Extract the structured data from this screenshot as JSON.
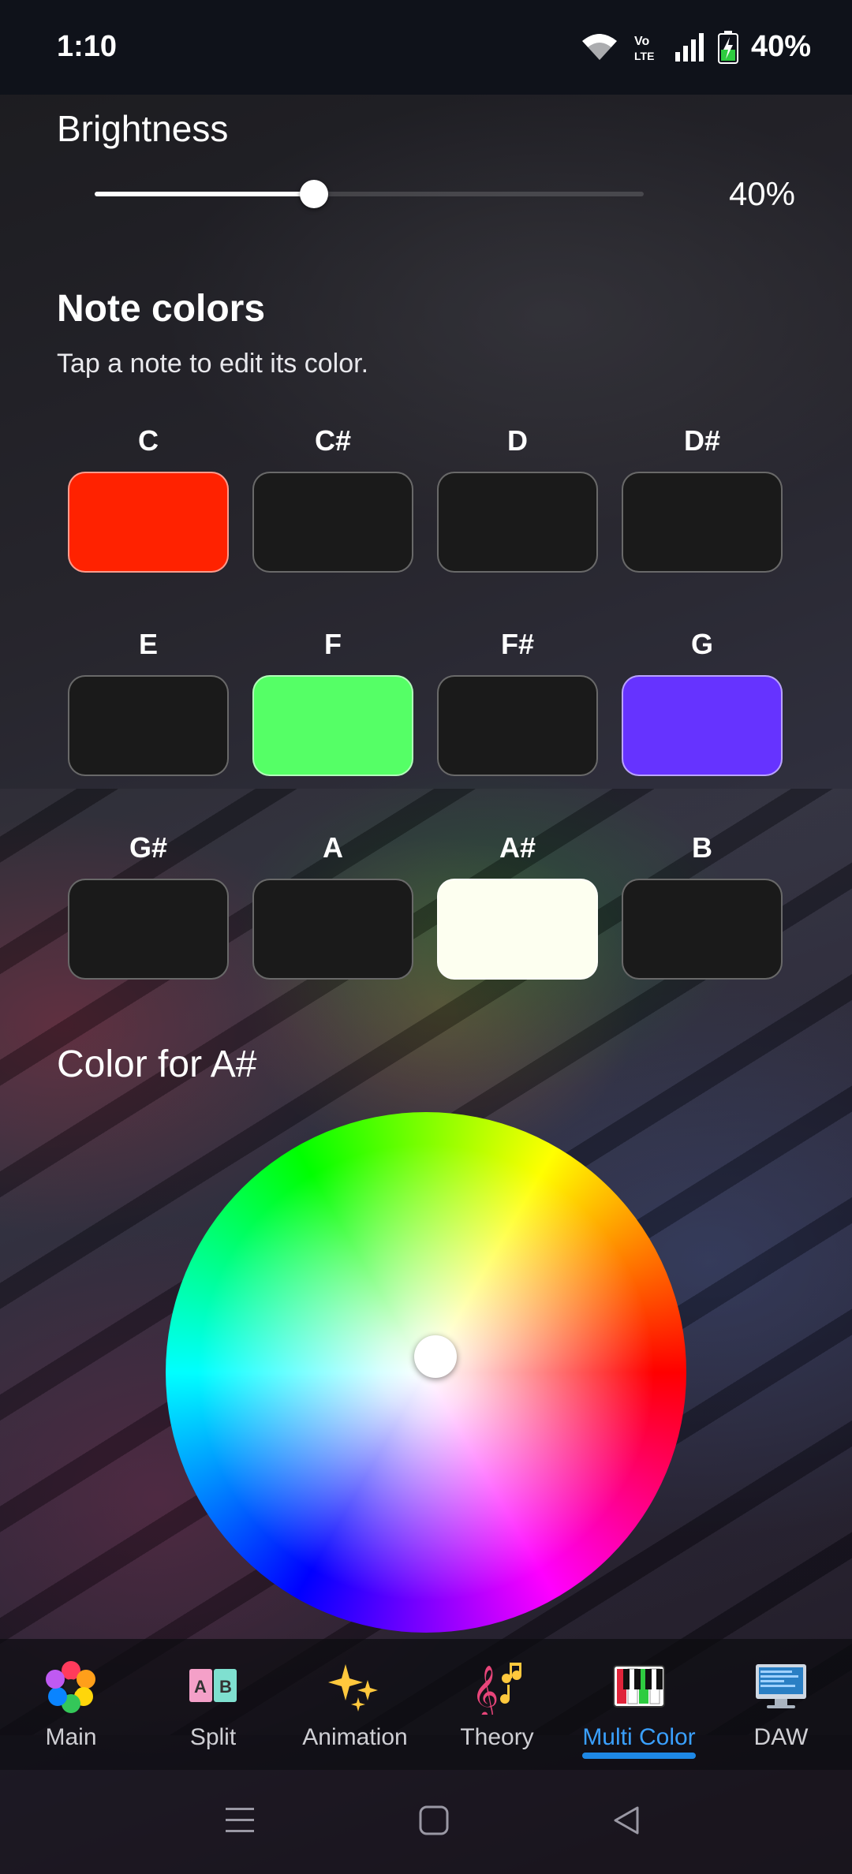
{
  "status_bar": {
    "time": "1:10",
    "battery_percent": "40%",
    "icons": [
      "wifi-icon",
      "volte-icon",
      "signal-icon",
      "battery-charging-icon"
    ]
  },
  "brightness": {
    "title": "Brightness",
    "value_label": "40%",
    "value": 0.4
  },
  "note_colors": {
    "title": "Note colors",
    "subtitle": "Tap a note to edit its color.",
    "notes": [
      {
        "name": "C",
        "color": "#ff2200"
      },
      {
        "name": "C#",
        "color": "#1a1a1a"
      },
      {
        "name": "D",
        "color": "#1a1a1a"
      },
      {
        "name": "D#",
        "color": "#1a1a1a"
      },
      {
        "name": "E",
        "color": "#1a1a1a"
      },
      {
        "name": "F",
        "color": "#55ff66"
      },
      {
        "name": "F#",
        "color": "#1a1a1a"
      },
      {
        "name": "G",
        "color": "#6633ff"
      },
      {
        "name": "G#",
        "color": "#1a1a1a"
      },
      {
        "name": "A",
        "color": "#1a1a1a"
      },
      {
        "name": "A#",
        "color": "#fdfff0"
      },
      {
        "name": "B",
        "color": "#1a1a1a"
      }
    ]
  },
  "color_picker": {
    "title": "Color for A#",
    "selected_note": "A#",
    "selected_color": "#fdfff0"
  },
  "bottom_nav": {
    "items": [
      {
        "label": "Main",
        "icon": "flower-icon",
        "active": false
      },
      {
        "label": "Split",
        "icon": "split-ab-icon",
        "active": false
      },
      {
        "label": "Animation",
        "icon": "sparkles-icon",
        "active": false
      },
      {
        "label": "Theory",
        "icon": "treble-clef-icon",
        "active": false
      },
      {
        "label": "Multi Color",
        "icon": "piano-keys-icon",
        "active": true
      },
      {
        "label": "DAW",
        "icon": "monitor-icon",
        "active": false
      }
    ],
    "active_color": "#3aa0ff"
  },
  "system_nav": {
    "icons": [
      "menu-icon",
      "home-icon",
      "back-icon"
    ]
  }
}
